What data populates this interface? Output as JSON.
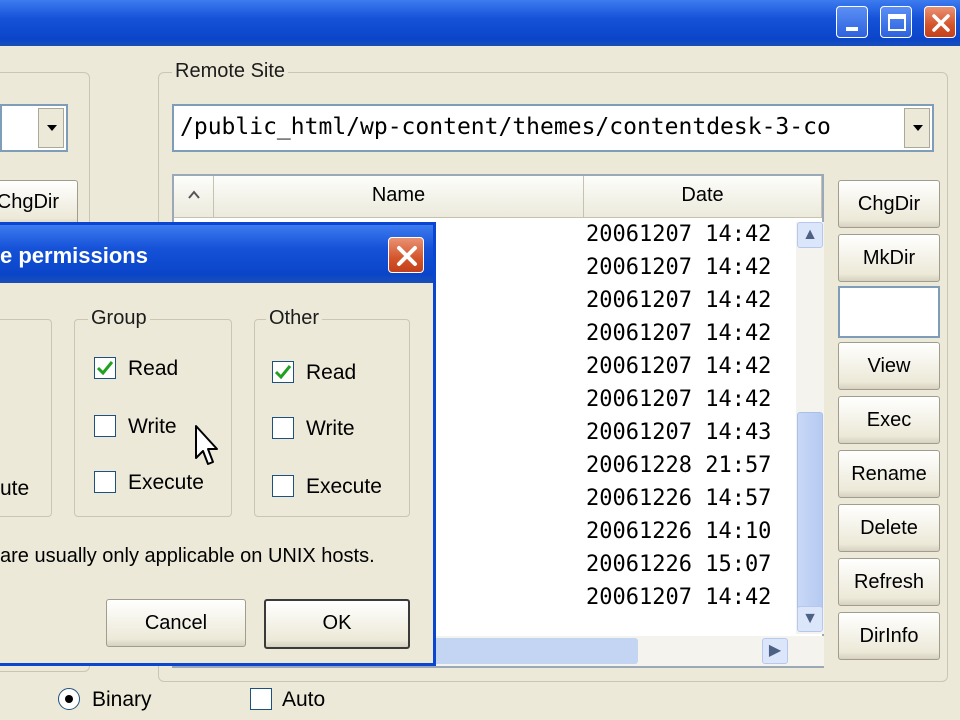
{
  "window": {
    "controls": [
      "minimize-icon",
      "maximize-icon",
      "close-icon"
    ]
  },
  "local_panel": {
    "chgdir_label": "ChgDir"
  },
  "remote_site": {
    "group_label": "Remote Site",
    "path": "/public_html/wp-content/themes/contentdesk-3-co",
    "columns": [
      "Name",
      "Date"
    ],
    "dates": [
      "20061207 14:42",
      "20061207 14:42",
      "20061207 14:42",
      "20061207 14:42",
      "20061207 14:42",
      "20061207 14:42",
      "20061207 14:43",
      "20061228 21:57",
      "20061226 14:57",
      "20061226 14:10",
      "20061226 15:07",
      "20061207 14:42"
    ],
    "buttons": {
      "chgdir": "ChgDir",
      "mkdir": "MkDir",
      "view": "View",
      "exec": "Exec",
      "rename": "Rename",
      "delete": "Delete",
      "refresh": "Refresh",
      "dirinfo": "DirInfo"
    }
  },
  "dialog": {
    "title": "e permissions",
    "owner_execute_fragment": "ute",
    "group": {
      "label": "Group",
      "read": "Read",
      "write": "Write",
      "execute": "Execute",
      "read_checked": true,
      "write_checked": false,
      "execute_checked": false
    },
    "other": {
      "label": "Other",
      "read": "Read",
      "write": "Write",
      "execute": "Execute",
      "read_checked": true,
      "write_checked": false,
      "execute_checked": false
    },
    "note": "are usually only applicable on UNIX hosts.",
    "cancel_label": "Cancel",
    "ok_label": "OK"
  },
  "transfer_mode": {
    "binary_label": "Binary",
    "auto_label": "Auto",
    "binary_selected": true,
    "auto_checked": false
  },
  "colors": {
    "title_blue": "#0a45c9",
    "face": "#ece9d8",
    "close_red": "#d4542a"
  }
}
